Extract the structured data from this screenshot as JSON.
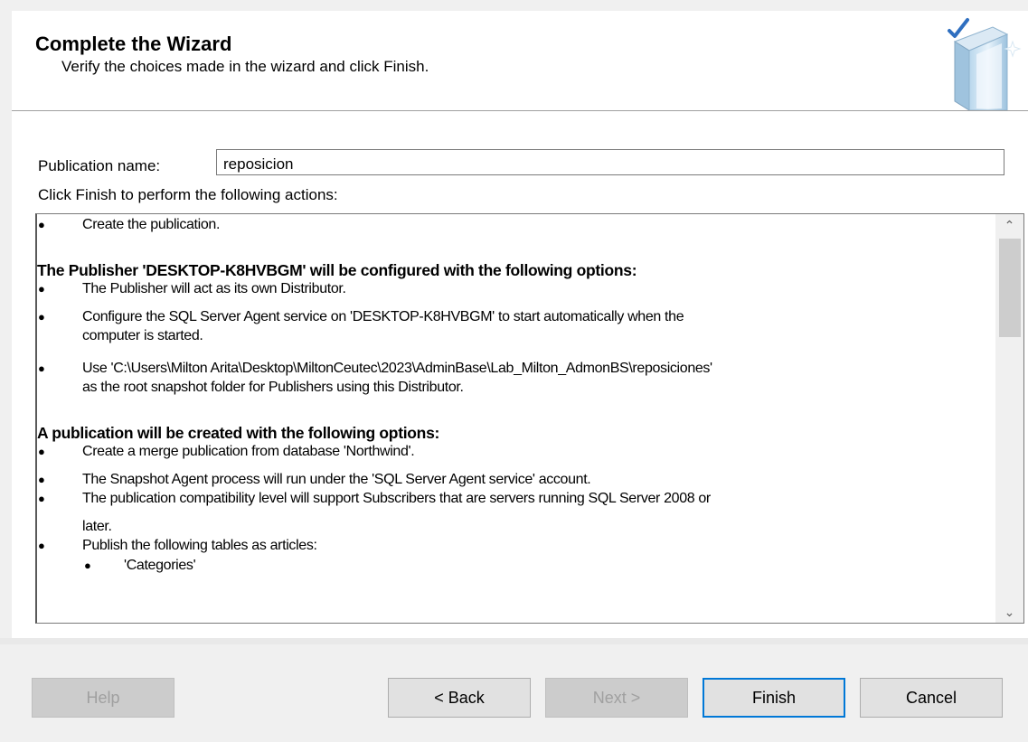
{
  "header": {
    "title": "Complete the Wizard",
    "subtitle": "Verify the choices made in the wizard and click Finish."
  },
  "publication_name": {
    "label": "Publication name:",
    "value": "reposicion"
  },
  "actions_label": "Click Finish to perform the following actions:",
  "actions": [
    {
      "type": "bullet",
      "text": "Create the publication."
    },
    {
      "type": "heading",
      "text": "The Publisher 'DESKTOP-K8HVBGM' will be configured with the following options:"
    },
    {
      "type": "bullet",
      "text": "The Publisher will act as its own Distributor."
    },
    {
      "type": "bullet",
      "text": "Configure the SQL Server Agent service on 'DESKTOP-K8HVBGM' to start automatically when the"
    },
    {
      "type": "cont",
      "text": "computer is started."
    },
    {
      "type": "bullet",
      "text": "Use 'C:\\Users\\Milton Arita\\Desktop\\MiltonCeutec\\2023\\AdminBase\\Lab_Milton_AdmonBS\\reposiciones'"
    },
    {
      "type": "cont",
      "text": "as the root snapshot folder for Publishers using this Distributor."
    },
    {
      "type": "heading",
      "text": "A publication will be created with the following options:"
    },
    {
      "type": "bullet",
      "text": "Create a merge publication from database 'Northwind'."
    },
    {
      "type": "bullet",
      "text": "The Snapshot Agent process will run under the 'SQL Server Agent service' account."
    },
    {
      "type": "bullet",
      "text": "The publication compatibility level will support Subscribers that are servers running SQL Server 2008 or"
    },
    {
      "type": "cont",
      "text": "later."
    },
    {
      "type": "bullet",
      "text": "Publish the following tables as articles:"
    },
    {
      "type": "sub",
      "text": "'Categories'"
    }
  ],
  "buttons": {
    "help": "Help",
    "back": "< Back",
    "next": "Next >",
    "finish": "Finish",
    "cancel": "Cancel"
  },
  "colors": {
    "accent": "#0078d7",
    "window_bg": "#f0f0f0"
  }
}
